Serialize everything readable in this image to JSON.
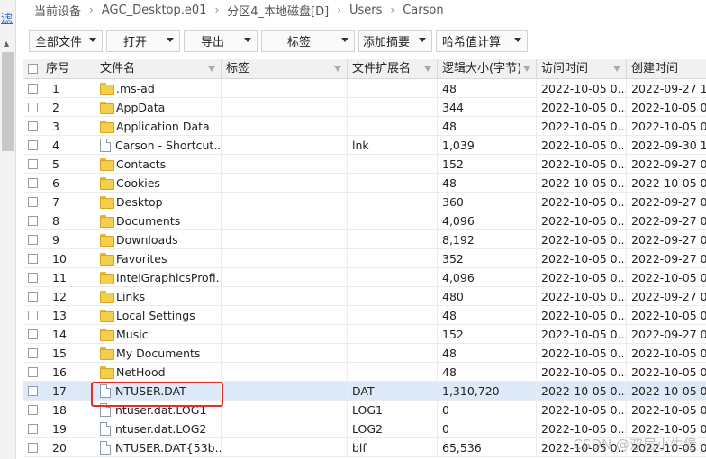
{
  "left": {
    "filter_label": "滤"
  },
  "breadcrumb": [
    "当前设备",
    "AGC_Desktop.e01",
    "分区4_本地磁盘[D]",
    "Users",
    "Carson"
  ],
  "toolbar": {
    "select_all": "全部文件",
    "open": "打开",
    "export": "导出",
    "tag": "标签",
    "add_digest": "添加摘要",
    "hash_calc": "哈希值计算"
  },
  "columns": {
    "seq": "序号",
    "name": "文件名",
    "tag": "标签",
    "ext": "文件扩展名",
    "size": "逻辑大小(字节)",
    "access": "访问时间",
    "created": "创建时间"
  },
  "rows": [
    {
      "seq": "1",
      "name": ".ms-ad",
      "type": "folder",
      "ext": "",
      "size": "48",
      "access": "2022-10-05 0...",
      "created": "2022-09-27 1..."
    },
    {
      "seq": "2",
      "name": "AppData",
      "type": "folder",
      "ext": "",
      "size": "344",
      "access": "2022-10-05 0...",
      "created": "2022-10-05 0..."
    },
    {
      "seq": "3",
      "name": "Application Data",
      "type": "folder",
      "ext": "",
      "size": "48",
      "access": "2022-10-05 0...",
      "created": "2022-10-05 0..."
    },
    {
      "seq": "4",
      "name": "Carson - Shortcut....",
      "type": "file",
      "ext": "lnk",
      "size": "1,039",
      "access": "2022-10-05 0...",
      "created": "2022-09-30 1..."
    },
    {
      "seq": "5",
      "name": "Contacts",
      "type": "folder",
      "ext": "",
      "size": "152",
      "access": "2022-10-05 0...",
      "created": "2022-09-27 0..."
    },
    {
      "seq": "6",
      "name": "Cookies",
      "type": "folder",
      "ext": "",
      "size": "48",
      "access": "2022-10-05 0...",
      "created": "2022-10-05 0..."
    },
    {
      "seq": "7",
      "name": "Desktop",
      "type": "folder",
      "ext": "",
      "size": "360",
      "access": "2022-10-05 0...",
      "created": "2022-09-27 0..."
    },
    {
      "seq": "8",
      "name": "Documents",
      "type": "folder",
      "ext": "",
      "size": "4,096",
      "access": "2022-10-05 0...",
      "created": "2022-09-27 0..."
    },
    {
      "seq": "9",
      "name": "Downloads",
      "type": "folder",
      "ext": "",
      "size": "8,192",
      "access": "2022-10-05 0...",
      "created": "2022-09-27 0..."
    },
    {
      "seq": "10",
      "name": "Favorites",
      "type": "folder",
      "ext": "",
      "size": "352",
      "access": "2022-10-05 0...",
      "created": "2022-09-27 0..."
    },
    {
      "seq": "11",
      "name": "IntelGraphicsProfi...",
      "type": "folder",
      "ext": "",
      "size": "4,096",
      "access": "2022-10-05 0...",
      "created": "2022-10-05 0..."
    },
    {
      "seq": "12",
      "name": "Links",
      "type": "folder",
      "ext": "",
      "size": "480",
      "access": "2022-10-05 0...",
      "created": "2022-09-27 0..."
    },
    {
      "seq": "13",
      "name": "Local Settings",
      "type": "folder",
      "ext": "",
      "size": "48",
      "access": "2022-10-05 0...",
      "created": "2022-10-05 0..."
    },
    {
      "seq": "14",
      "name": "Music",
      "type": "folder",
      "ext": "",
      "size": "152",
      "access": "2022-10-05 0...",
      "created": "2022-09-27 0..."
    },
    {
      "seq": "15",
      "name": "My Documents",
      "type": "folder",
      "ext": "",
      "size": "48",
      "access": "2022-10-05 0...",
      "created": "2022-10-05 0..."
    },
    {
      "seq": "16",
      "name": "NetHood",
      "type": "folder",
      "ext": "",
      "size": "48",
      "access": "2022-10-05 0...",
      "created": "2022-10-05 0..."
    },
    {
      "seq": "17",
      "name": "NTUSER.DAT",
      "type": "file",
      "ext": "DAT",
      "size": "1,310,720",
      "access": "2022-10-05 0...",
      "created": "2022-10-05 0...",
      "selected": true
    },
    {
      "seq": "18",
      "name": "ntuser.dat.LOG1",
      "type": "file",
      "ext": "LOG1",
      "size": "0",
      "access": "2022-10-05 0...",
      "created": "2022-10-05 0..."
    },
    {
      "seq": "19",
      "name": "ntuser.dat.LOG2",
      "type": "file",
      "ext": "LOG2",
      "size": "0",
      "access": "2022-10-05 0...",
      "created": "2022-10-05 0..."
    },
    {
      "seq": "20",
      "name": "NTUSER.DAT{53b...",
      "type": "file",
      "ext": "blf",
      "size": "65,536",
      "access": "2022-10-05 0...",
      "created": "2022-10-05 0..."
    }
  ],
  "watermark": "CSDN @双层小牛堡"
}
